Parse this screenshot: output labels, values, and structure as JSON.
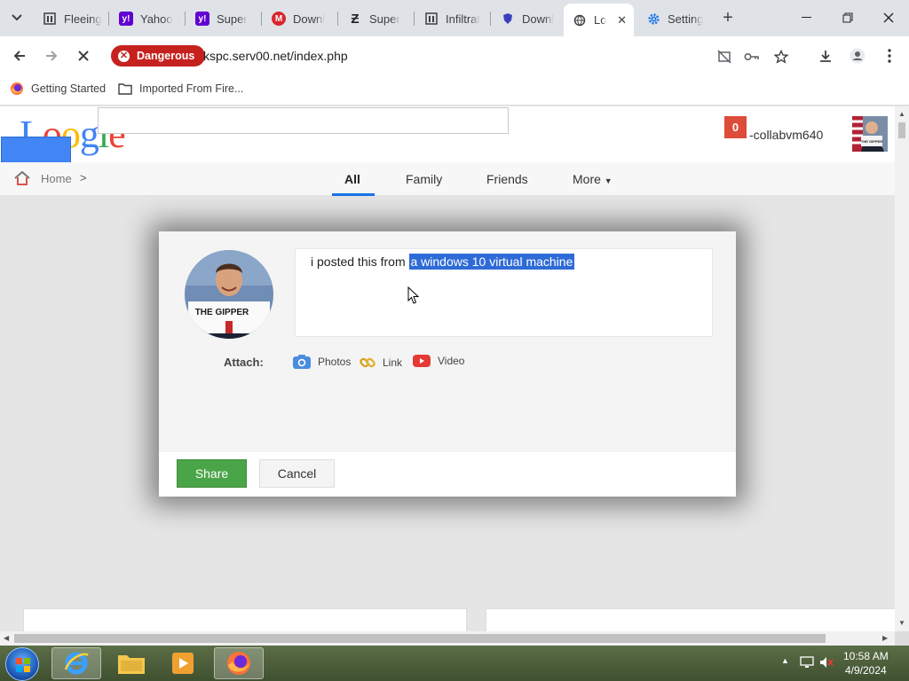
{
  "browser": {
    "tabs": [
      {
        "title": "Fleeing",
        "favicon": "page-icon",
        "color": "#3c4043"
      },
      {
        "title": "Yahoo",
        "favicon": "yahoo-icon",
        "color": "#6001d2"
      },
      {
        "title": "Super",
        "favicon": "yahoo-icon",
        "color": "#6001d2"
      },
      {
        "title": "Downl",
        "favicon": "mega-icon",
        "color": "#d9272e"
      },
      {
        "title": "Super",
        "favicon": "z-icon",
        "color": "#222"
      },
      {
        "title": "Infiltrat",
        "favicon": "page-icon",
        "color": "#3c4043"
      },
      {
        "title": "Downl",
        "favicon": "shield-icon",
        "color": "#3b3fbf"
      },
      {
        "title": "Lo",
        "favicon": "globe-icon",
        "color": "#3c4043",
        "active": true
      },
      {
        "title": "Setting",
        "favicon": "gear-icon",
        "color": "#1a73e8"
      }
    ],
    "security_badge": "Dangerous",
    "url": "kspc.serv00.net/index.php",
    "bookmarks": [
      {
        "label": "Getting Started",
        "icon": "firefox-icon"
      },
      {
        "label": "Imported From Fire...",
        "icon": "folder-icon"
      }
    ]
  },
  "site": {
    "logo_letters": [
      "L",
      "o",
      "o",
      "g",
      "l",
      "e"
    ],
    "logo_colors": [
      "#4285f4",
      "#ea4335",
      "#fbbc05",
      "#4285f4",
      "#34a853",
      "#ea4335"
    ],
    "notification_count": "0",
    "username": "-collabvm640",
    "breadcrumb": {
      "home": "Home",
      "separator": ">"
    },
    "nav_tabs": [
      {
        "label": "All",
        "active": true
      },
      {
        "label": "Family"
      },
      {
        "label": "Friends"
      },
      {
        "label": "More"
      }
    ]
  },
  "composer": {
    "text_plain": "i posted this from ",
    "text_selected": "a windows 10 virtual machine",
    "avatar_caption": "THE GIPPER",
    "attach_label": "Attach:",
    "attachments": [
      {
        "label": "Photos",
        "icon": "camera-icon"
      },
      {
        "label": "Link",
        "icon": "link-icon"
      },
      {
        "label": "Video",
        "icon": "youtube-icon"
      }
    ],
    "share_label": "Share",
    "cancel_label": "Cancel",
    "colors": {
      "share": "#4aa548",
      "selection": "#2f6bd6",
      "notification": "#dd4b39"
    }
  },
  "taskbar": {
    "time": "10:58 AM",
    "date": "4/9/2024"
  }
}
